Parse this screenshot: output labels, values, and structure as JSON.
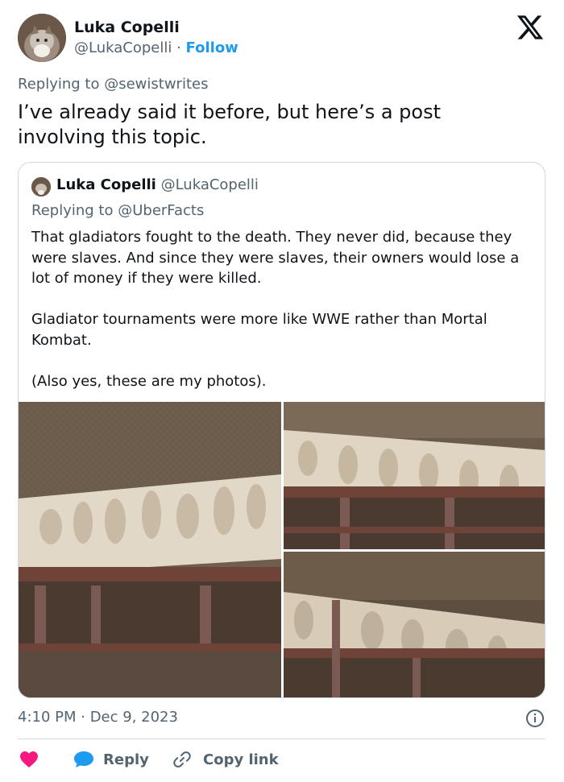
{
  "author": {
    "name": "Luka Copelli",
    "handle": "@LukaCopelli",
    "separator": "·",
    "follow_label": "Follow"
  },
  "reply": {
    "prefix": "Replying to",
    "mention": "@sewistwrites"
  },
  "tweet_text": "I’ve already said it before, but here’s a post involving this topic.",
  "quote": {
    "name": "Luka Copelli",
    "handle": "@LukaCopelli",
    "reply_prefix": "Replying to",
    "reply_mention": "@UberFacts",
    "paragraphs": [
      "That gladiators fought to the death. They never did, because they were slaves. And since they were slaves, their owners would lose a lot of money if they were killed.",
      "Gladiator tournaments were more like WWE rather than Mortal Kombat.",
      "(Also yes, these are my photos)."
    ],
    "photos": [
      "relief-photo-1",
      "relief-photo-2",
      "relief-photo-3"
    ]
  },
  "timestamp": "4:10 PM · Dec 9, 2023",
  "actions": {
    "like_icon": "heart-icon",
    "reply_label": "Reply",
    "copy_label": "Copy link"
  },
  "colors": {
    "link_blue": "#1d9bf0",
    "like_pink": "#f91880",
    "secondary_text": "#536471",
    "border": "#cfd9de"
  }
}
